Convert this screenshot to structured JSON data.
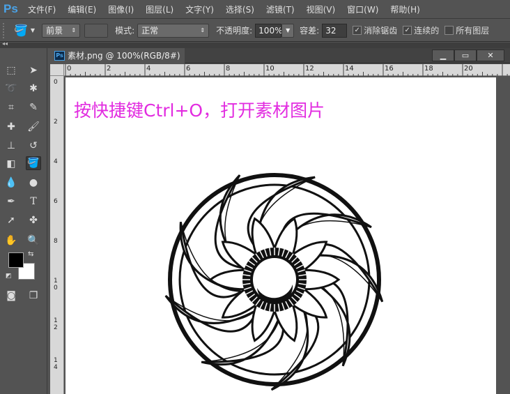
{
  "app": {
    "logo": "Ps"
  },
  "menu": [
    "文件(F)",
    "编辑(E)",
    "图像(I)",
    "图层(L)",
    "文字(Y)",
    "选择(S)",
    "滤镜(T)",
    "视图(V)",
    "窗口(W)",
    "帮助(H)"
  ],
  "options": {
    "fill_source": "前景",
    "mode_label": "模式:",
    "mode_value": "正常",
    "opacity_label": "不透明度:",
    "opacity_value": "100%",
    "tolerance_label": "容差:",
    "tolerance_value": "32",
    "antialias_label": "消除锯齿",
    "antialias_checked": true,
    "contiguous_label": "连续的",
    "contiguous_checked": true,
    "all_layers_label": "所有图层",
    "all_layers_checked": false
  },
  "document": {
    "title": "素材.png @ 100%(RGB/8#)",
    "ruler_h": [
      "0",
      "2",
      "4",
      "6",
      "8",
      "10",
      "12",
      "14",
      "16",
      "18",
      "20"
    ],
    "ruler_v": [
      "0",
      "2",
      "4",
      "6",
      "8",
      "1 0",
      "1 2",
      "1 4"
    ],
    "caption": "按快捷键Ctrl+O，打开素材图片"
  },
  "colors": {
    "foreground": "#000000",
    "background": "#ffffff",
    "caption": "#e22ce0"
  }
}
